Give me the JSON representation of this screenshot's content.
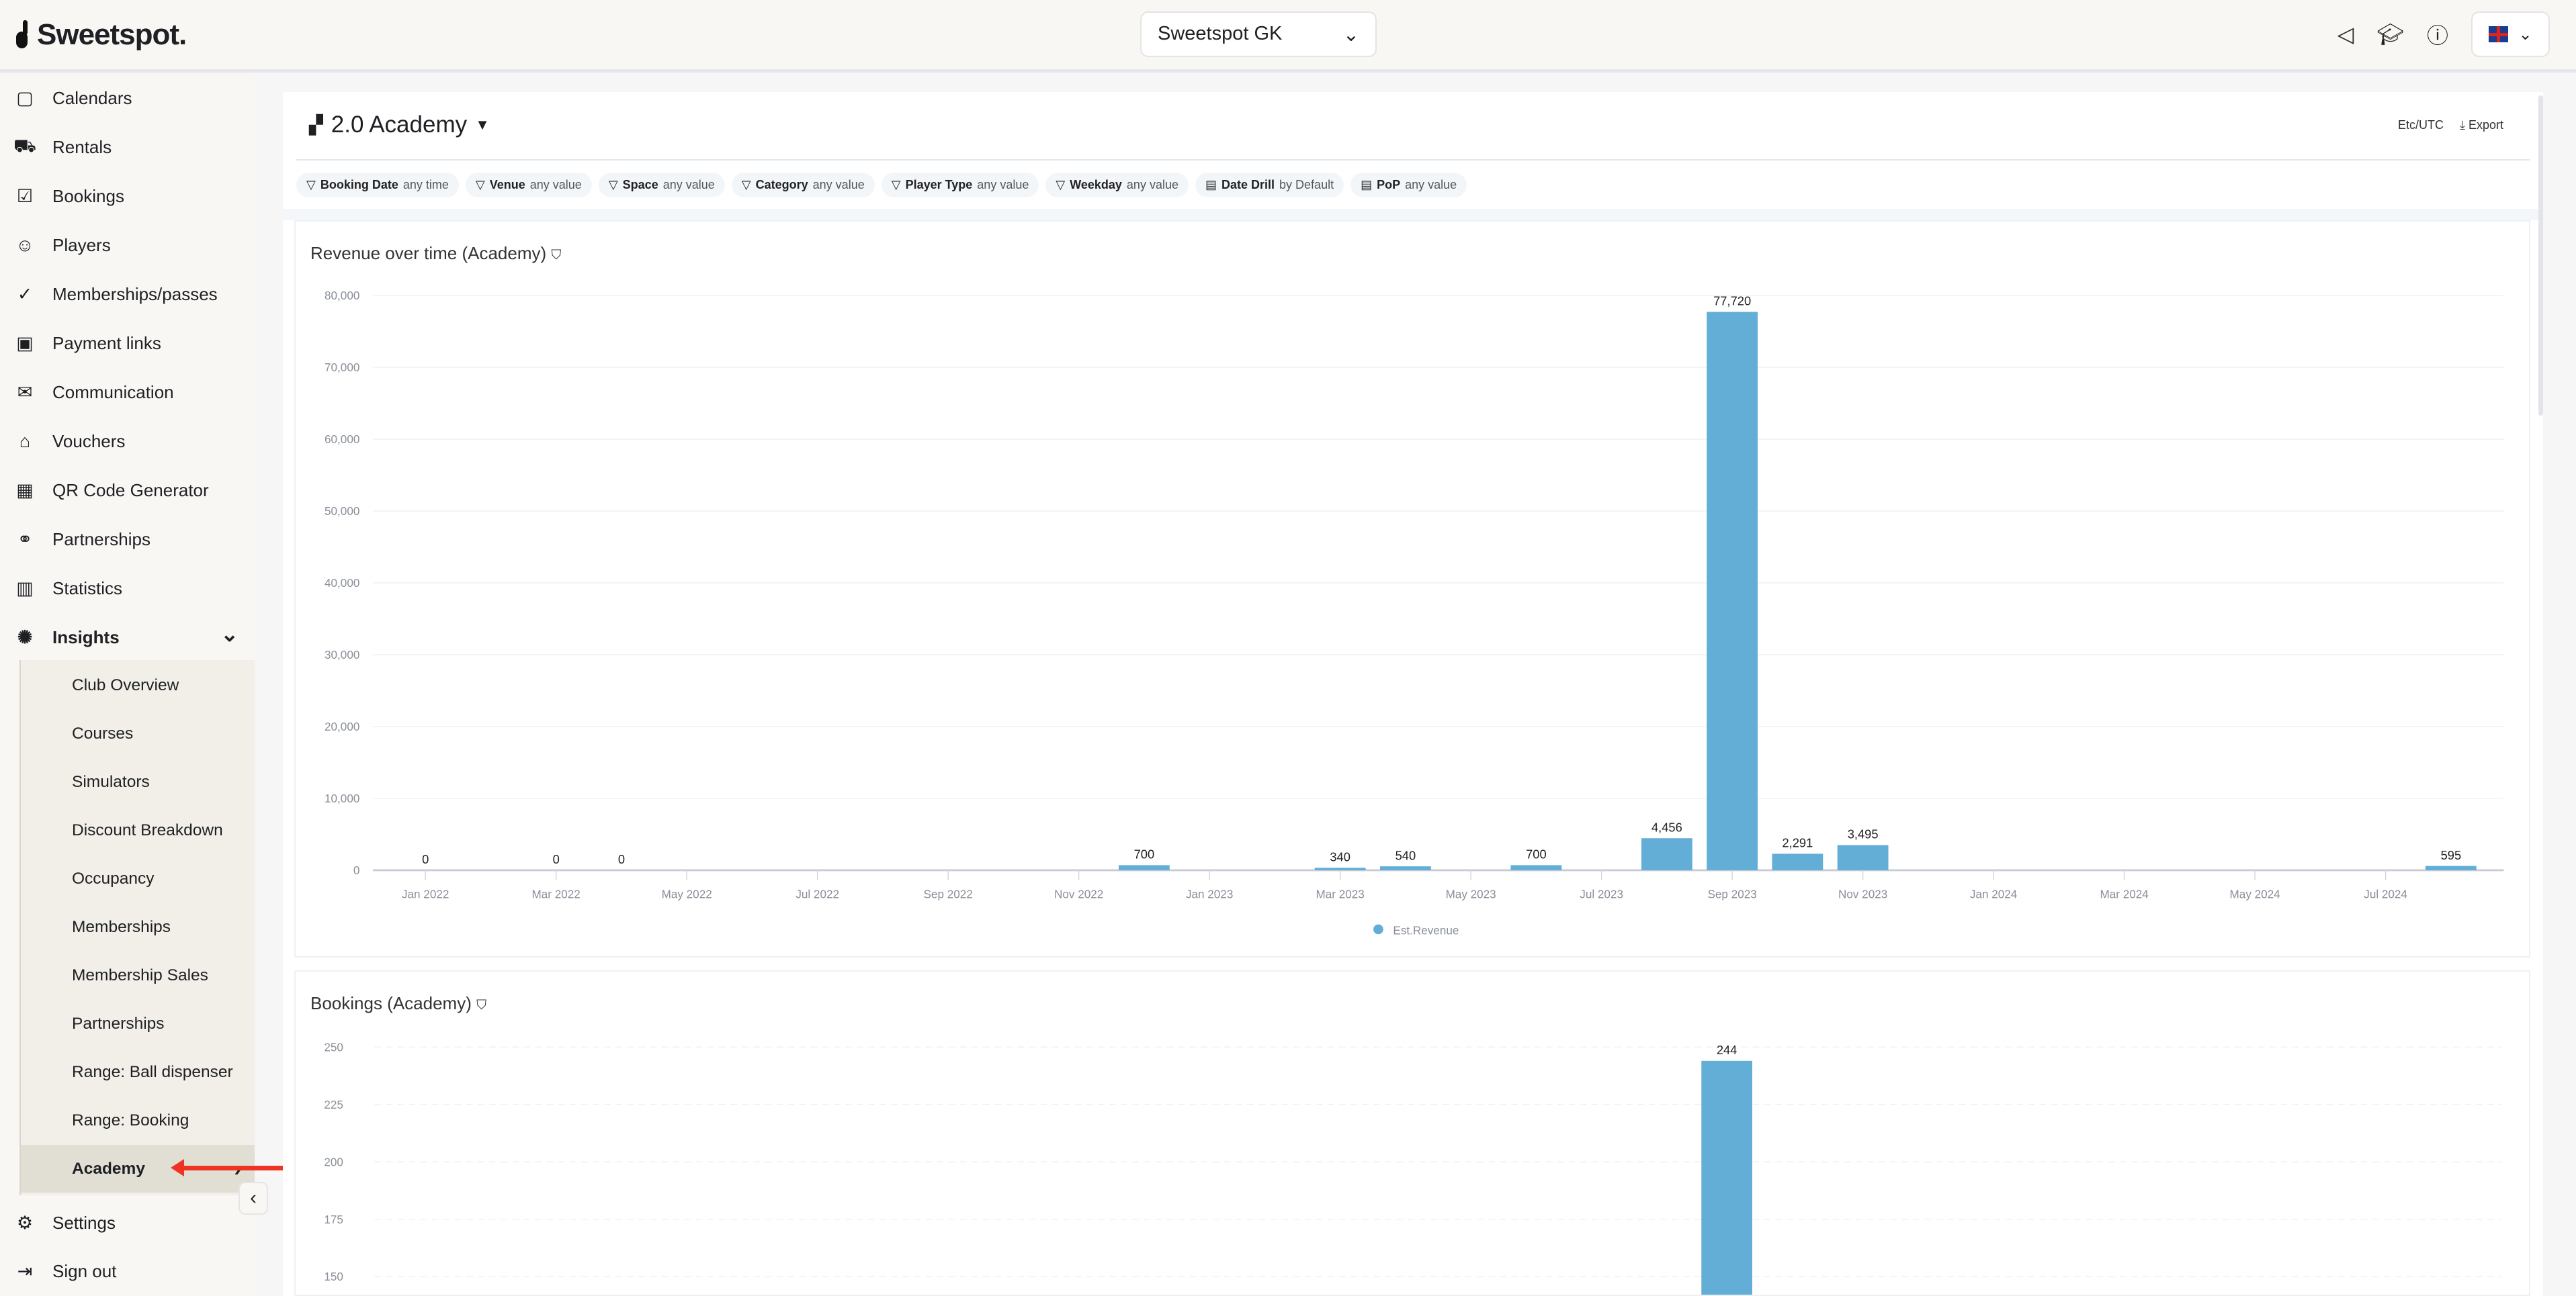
{
  "header": {
    "logo": "Sweetspot.",
    "venue": "Sweetspot GK",
    "icons": [
      "megaphone-icon",
      "graduation-cap-icon",
      "help-icon"
    ],
    "language": "uk-flag"
  },
  "sidebar": {
    "items": [
      {
        "label": "Calendars",
        "icon": "calendar-icon",
        "glyph": "▢"
      },
      {
        "label": "Rentals",
        "icon": "golf-cart-icon",
        "glyph": "⛟"
      },
      {
        "label": "Bookings",
        "icon": "booking-icon",
        "glyph": "☑"
      },
      {
        "label": "Players",
        "icon": "players-icon",
        "glyph": "☺"
      },
      {
        "label": "Memberships/passes",
        "icon": "membership-icon",
        "glyph": "✓"
      },
      {
        "label": "Payment links",
        "icon": "payment-link-icon",
        "glyph": "▣"
      },
      {
        "label": "Communication",
        "icon": "mail-icon",
        "glyph": "✉"
      },
      {
        "label": "Vouchers",
        "icon": "gift-icon",
        "glyph": "⌂"
      },
      {
        "label": "QR Code Generator",
        "icon": "qr-code-icon",
        "glyph": "▦"
      },
      {
        "label": "Partnerships",
        "icon": "handshake-icon",
        "glyph": "⚭"
      },
      {
        "label": "Statistics",
        "icon": "bar-chart-icon",
        "glyph": "▥"
      },
      {
        "label": "Insights",
        "icon": "lightbulb-icon",
        "glyph": "✺"
      }
    ],
    "insights_sub": [
      "Club Overview",
      "Courses",
      "Simulators",
      "Discount Breakdown",
      "Occupancy",
      "Memberships",
      "Membership Sales",
      "Partnerships",
      "Range: Ball dispenser",
      "Range: Booking",
      "Academy"
    ],
    "active": "Academy",
    "bottom": [
      {
        "label": "Settings",
        "icon": "gear-icon",
        "glyph": "⚙"
      },
      {
        "label": "Sign out",
        "icon": "sign-out-icon",
        "glyph": "⇥"
      }
    ]
  },
  "dashboard": {
    "title": "2.0 Academy",
    "timezone": "Etc/UTC",
    "export": "Export",
    "filters": [
      {
        "name": "Booking Date",
        "value": "any time",
        "icon": "filter-icon"
      },
      {
        "name": "Venue",
        "value": "any value",
        "icon": "filter-icon"
      },
      {
        "name": "Space",
        "value": "any value",
        "icon": "filter-icon"
      },
      {
        "name": "Category",
        "value": "any value",
        "icon": "filter-icon"
      },
      {
        "name": "Player Type",
        "value": "any value",
        "icon": "filter-icon"
      },
      {
        "name": "Weekday",
        "value": "any value",
        "icon": "filter-icon"
      },
      {
        "name": "Date Drill",
        "value": "by Default",
        "icon": "calendar-settings-icon"
      },
      {
        "name": "PoP",
        "value": "any value",
        "icon": "calendar-trend-icon"
      }
    ]
  },
  "chart_data": [
    {
      "type": "bar",
      "title": "Revenue over time (Academy)",
      "color": "#62aed6",
      "x_ticks": [
        "Jan 2022",
        "Mar 2022",
        "May 2022",
        "Jul 2022",
        "Sep 2022",
        "Nov 2022",
        "Jan 2023",
        "Mar 2023",
        "May 2023",
        "Jul 2023",
        "Sep 2023",
        "Nov 2023",
        "Jan 2024",
        "Mar 2024",
        "May 2024",
        "Jul 2024"
      ],
      "y_ticks": [
        "0",
        "10,000",
        "20,000",
        "30,000",
        "40,000",
        "50,000",
        "60,000",
        "70,000",
        "80,000"
      ],
      "ylim": [
        0,
        80000
      ],
      "legend": "Est.Revenue",
      "legend_position": "bottom",
      "grid": true,
      "categories": [
        "Jan 2022",
        "Mar 2022",
        "Apr 2022",
        "Dec 2022",
        "Mar 2023",
        "Apr 2023",
        "Jun 2023",
        "Aug 2023",
        "Sep 2023",
        "Oct 2023",
        "Nov 2023",
        "Aug 2024"
      ],
      "values": [
        0,
        0,
        0,
        700,
        340,
        540,
        700,
        4456,
        77720,
        2291,
        3495,
        595
      ],
      "labels": [
        "0",
        "0",
        "0",
        "700",
        "340",
        "540",
        "700",
        "4,456",
        "77,720",
        "2,291",
        "3,495",
        "595"
      ]
    },
    {
      "type": "bar",
      "title": "Bookings (Academy)",
      "color": "#62aed6",
      "y_ticks": [
        "150",
        "175",
        "200",
        "225",
        "250"
      ],
      "grid": true,
      "categories": [
        "Sep 2023"
      ],
      "values": [
        244
      ],
      "labels": [
        "244"
      ]
    }
  ]
}
